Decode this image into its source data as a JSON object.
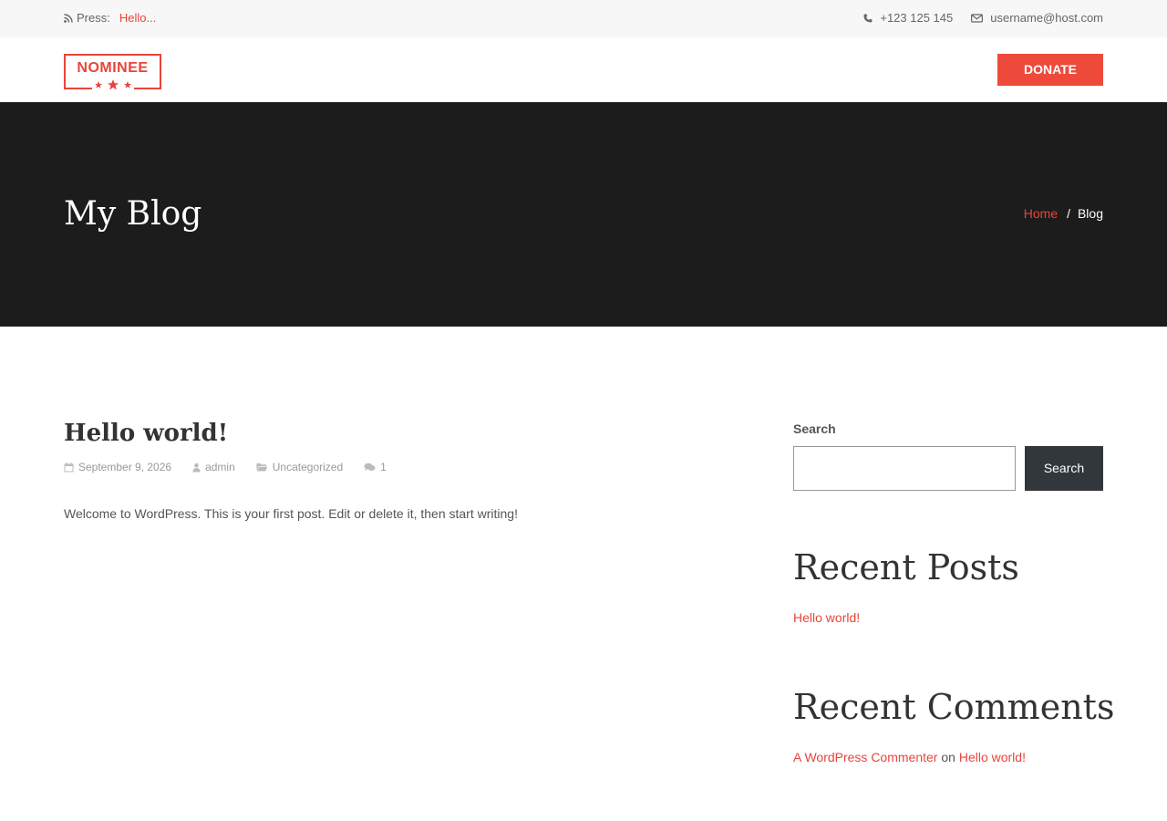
{
  "topbar": {
    "press_label": "Press:",
    "press_link": "Hello...",
    "phone": "+123 125 145",
    "email": "username@host.com"
  },
  "header": {
    "logo_text": "NOMINEE",
    "donate_label": "DONATE"
  },
  "hero": {
    "title": "My Blog",
    "breadcrumb_home": "Home",
    "breadcrumb_sep": "/",
    "breadcrumb_current": "Blog"
  },
  "post": {
    "title": "Hello world!",
    "date": "September 9, 2026",
    "author": "admin",
    "category": "Uncategorized",
    "comments": "1",
    "excerpt": "Welcome to WordPress. This is your first post. Edit or delete it, then start writing!"
  },
  "sidebar": {
    "search_label": "Search",
    "search_value": "",
    "search_button": "Search",
    "recent_posts_title": "Recent Posts",
    "recent_posts": [
      "Hello world!"
    ],
    "recent_comments_title": "Recent Comments",
    "comment_author": "A WordPress Commenter",
    "comment_on": "on",
    "comment_post": "Hello world!"
  },
  "colors": {
    "accent": "#e8443a",
    "hero_bg": "#1c1c1c",
    "button_dark": "#32373c"
  },
  "icons": [
    "rss-icon",
    "phone-icon",
    "envelope-icon",
    "calendar-icon",
    "user-icon",
    "folder-icon",
    "comments-icon"
  ]
}
